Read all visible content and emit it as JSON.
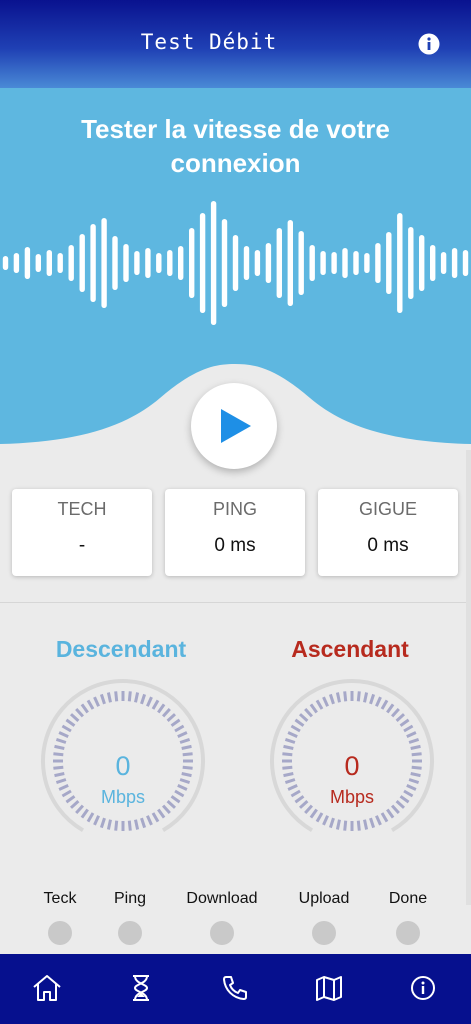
{
  "app_bar": {
    "title": "Test Débit",
    "info_icon": "info-icon"
  },
  "hero": {
    "title": "Tester la vitesse de votre connexion",
    "background": "#5eb7e0"
  },
  "play_button": {
    "icon": "play-icon",
    "color": "#1e8fe6"
  },
  "stats": [
    {
      "label": "TECH",
      "value": "-"
    },
    {
      "label": "PING",
      "value": "0 ms"
    },
    {
      "label": "GIGUE",
      "value": "0 ms"
    }
  ],
  "gauges": {
    "download": {
      "title": "Descendant",
      "value": "0",
      "unit": "Mbps",
      "color": "#5ab4de"
    },
    "upload": {
      "title": "Ascendant",
      "value": "0",
      "unit": "Mbps",
      "color": "#b72a1e"
    }
  },
  "steps": [
    {
      "label": "Teck"
    },
    {
      "label": "Ping"
    },
    {
      "label": "Download"
    },
    {
      "label": "Upload"
    },
    {
      "label": "Done"
    }
  ],
  "nav": {
    "items": [
      {
        "icon": "home-icon"
      },
      {
        "icon": "hourglass-icon"
      },
      {
        "icon": "phone-icon"
      },
      {
        "icon": "map-icon"
      },
      {
        "icon": "info-icon"
      }
    ],
    "background": "#06108e"
  }
}
